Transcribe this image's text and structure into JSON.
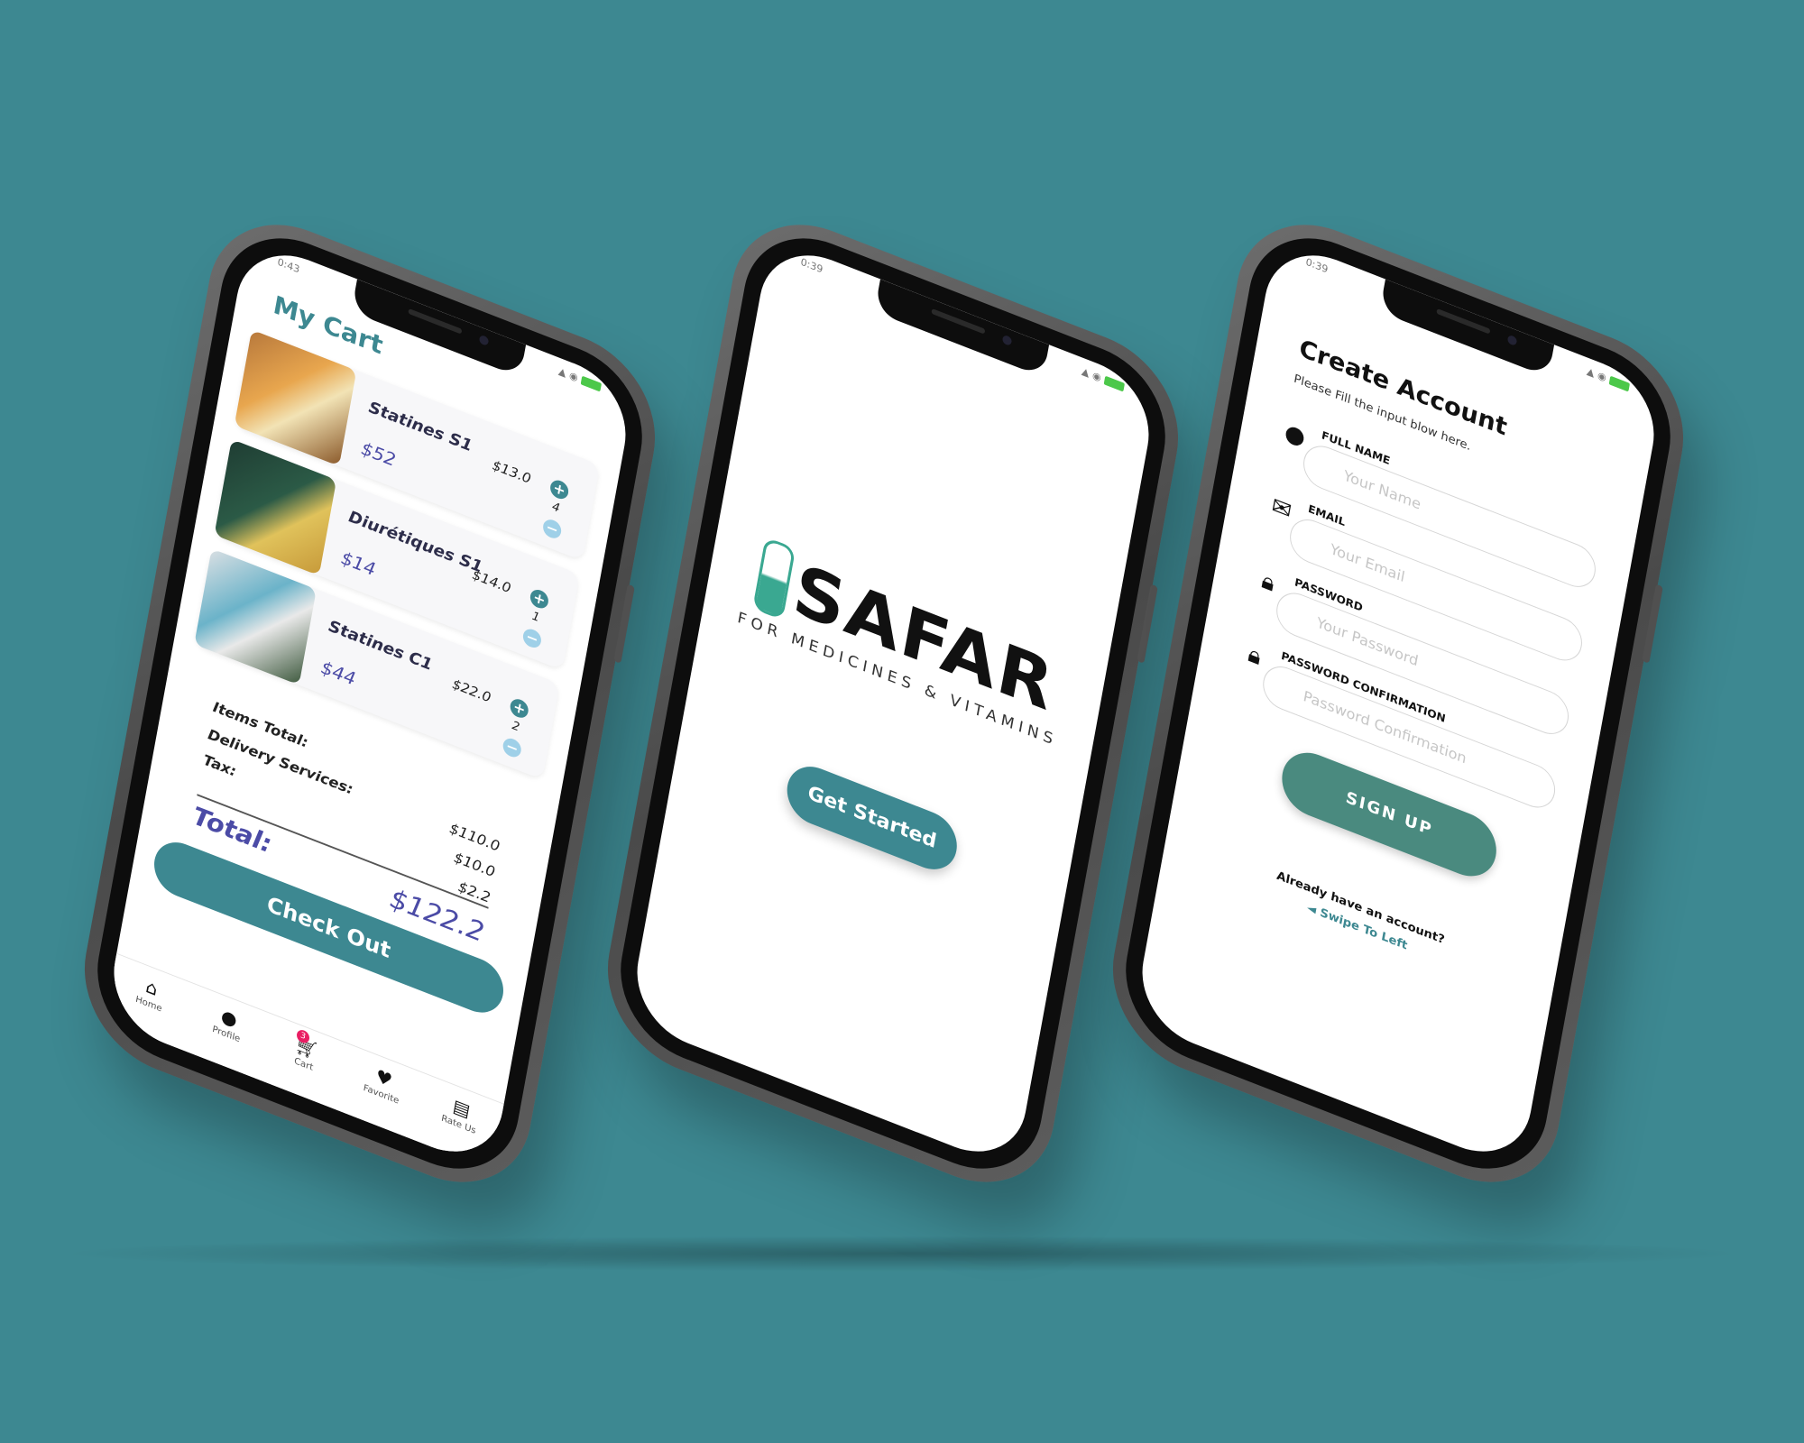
{
  "colors": {
    "background": "#3d8891",
    "accent": "#3d8891",
    "price": "#4b4ba6",
    "badge": "#e91e63",
    "signup": "#4a8a7f"
  },
  "status": {
    "time_left_1": "0:43",
    "time_left_2": "0:39",
    "time_left_3": "0:39"
  },
  "cart": {
    "title": "My Cart",
    "items": [
      {
        "name": "Statines S1",
        "unit_price": "$13.0",
        "price": "$52",
        "qty": "4",
        "thumb": "supplement-packs"
      },
      {
        "name": "Diurétiques S1",
        "unit_price": "$14.0",
        "price": "$14",
        "qty": "1",
        "thumb": "ashwagandha-packs"
      },
      {
        "name": "Statines C1",
        "unit_price": "$22.0",
        "price": "$44",
        "qty": "2",
        "thumb": "vitamin-bottles"
      }
    ],
    "plus_label": "+",
    "minus_label": "−",
    "summary": {
      "items_total_label": "Items Total:",
      "items_total_value": "$110.0",
      "delivery_label": "Delivery Services:",
      "delivery_value": "$10.0",
      "tax_label": "Tax:",
      "tax_value": "$2.2",
      "total_label": "Total:",
      "total_value": "$122.2"
    },
    "checkout_label": "Check Out",
    "tabs": [
      {
        "label": "Home",
        "icon": "home-icon"
      },
      {
        "label": "Profile",
        "icon": "user-icon"
      },
      {
        "label": "Cart",
        "icon": "cart-icon",
        "badge": "3"
      },
      {
        "label": "Favorite",
        "icon": "heart-icon"
      },
      {
        "label": "Rate Us",
        "icon": "chat-icon"
      }
    ]
  },
  "splash": {
    "logo_text": "SAFAR",
    "logo_sub": "FOR MEDICINES & VITAMINS",
    "cta": "Get Started"
  },
  "signup": {
    "title": "Create Account",
    "subtitle": "Please Fill the input blow here.",
    "fields": [
      {
        "label": "FULL NAME",
        "placeholder": "Your Name",
        "icon": "user-icon"
      },
      {
        "label": "EMAIL",
        "placeholder": "Your Email",
        "icon": "mail-icon"
      },
      {
        "label": "PASSWORD",
        "placeholder": "Your Password",
        "icon": "lock-icon"
      },
      {
        "label": "PASSWORD CONFIRMATION",
        "placeholder": "Password Confirmation",
        "icon": "lock-icon"
      }
    ],
    "button": "SIGN UP",
    "already": "Already have an account?",
    "swipe": "◄ Swipe To Left"
  }
}
